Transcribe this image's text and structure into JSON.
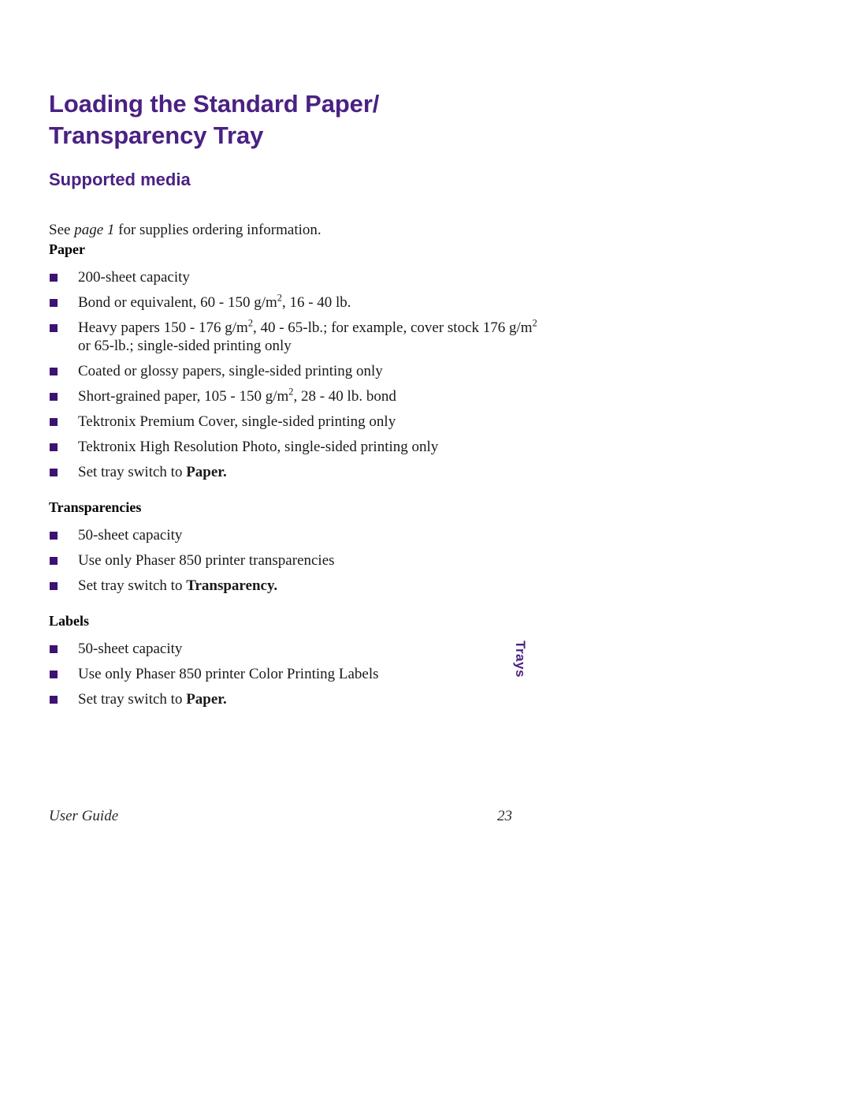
{
  "page": {
    "title_line1": "Loading the Standard Paper/",
    "title_line2": "Transparency Tray",
    "section_heading": "Supported media",
    "intro": {
      "before": "See ",
      "italic": "page 1",
      "after": " for supplies ordering information."
    }
  },
  "colors": {
    "heading_purple": "#4a2183",
    "bullet_purple": "#3d1273",
    "body_text": "#1a1a1a",
    "page_background": "#ffffff"
  },
  "groups": [
    {
      "label": "Paper",
      "items": [
        {
          "text": "200-sheet capacity"
        },
        {
          "pre": "Bond or equivalent, 60 - 150 g/m",
          "sup": "2",
          "post": ", 16 - 40 lb."
        },
        {
          "pre": "Heavy papers 150 - 176 g/m",
          "sup": "2",
          "mid": ", 40 - 65-lb.; for example, cover stock 176 g/m",
          "sup2": "2",
          "post": " or 65-lb.; single-sided printing only"
        },
        {
          "text": "Coated or glossy papers, single-sided printing only"
        },
        {
          "pre": "Short-grained paper, 105 - 150 g/m",
          "sup": "2",
          "post": ",  28 - 40 lb. bond"
        },
        {
          "text": "Tektronix Premium Cover, single-sided printing only"
        },
        {
          "text": "Tektronix High Resolution Photo, single-sided printing only"
        },
        {
          "pre": "Set tray switch to ",
          "bold": "Paper."
        }
      ]
    },
    {
      "label": "Transparencies",
      "items": [
        {
          "text": "50-sheet capacity"
        },
        {
          "text": "Use only Phaser 850 printer transparencies"
        },
        {
          "pre": "Set tray switch to ",
          "bold": "Transparency."
        }
      ]
    },
    {
      "label": "Labels",
      "items": [
        {
          "text": "50-sheet capacity"
        },
        {
          "text": "Use only Phaser 850 printer Color Printing Labels"
        },
        {
          "pre": "Set tray switch to ",
          "bold": "Paper."
        }
      ]
    }
  ],
  "side_tab": {
    "label": "Trays"
  },
  "footer": {
    "left": "User Guide",
    "page_number": "23"
  }
}
